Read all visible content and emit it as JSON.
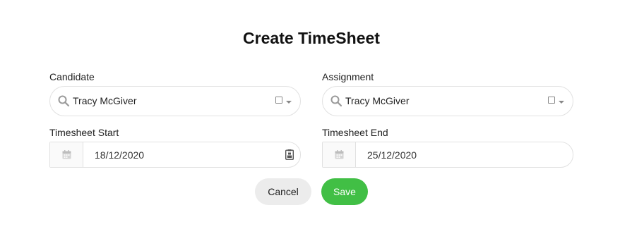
{
  "dialog": {
    "title": "Create TimeSheet"
  },
  "form": {
    "candidate": {
      "label": "Candidate",
      "value": "Tracy McGiver"
    },
    "assignment": {
      "label": "Assignment",
      "value": "Tracy McGiver"
    },
    "timesheet_start": {
      "label": "Timesheet Start",
      "value": "18/12/2020"
    },
    "timesheet_end": {
      "label": "Timesheet End",
      "value": "25/12/2020"
    }
  },
  "actions": {
    "cancel_label": "Cancel",
    "save_label": "Save"
  },
  "colors": {
    "save_button": "#41bf45",
    "cancel_button": "#ececec",
    "border": "#e1e1e1"
  },
  "icons": {
    "search": "search-icon",
    "clear": "clear-icon",
    "dropdown": "chevron-down-icon",
    "calendar": "calendar-icon",
    "date_picker": "date-picker-icon"
  }
}
